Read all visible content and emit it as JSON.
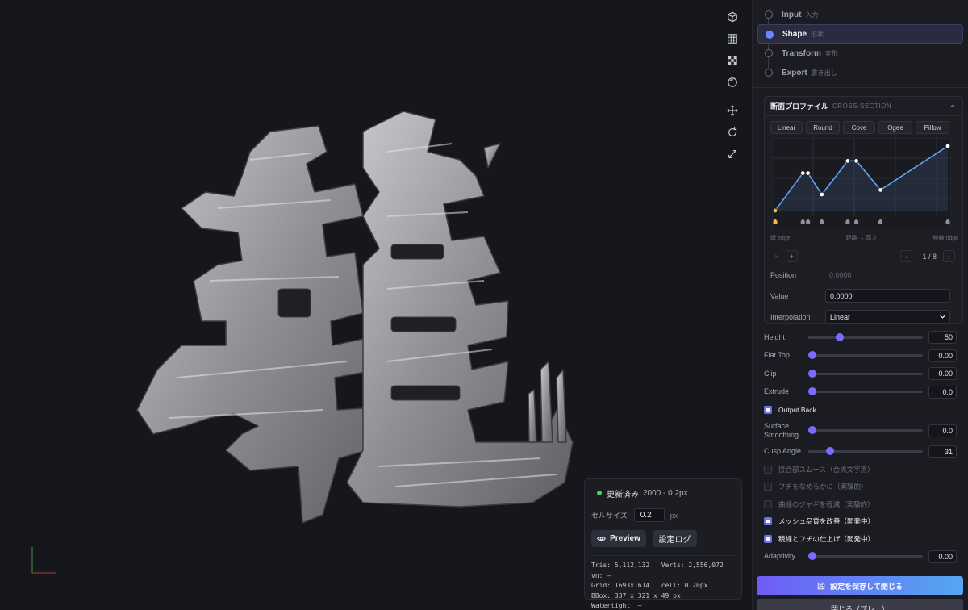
{
  "viewport": {
    "toolbar": [
      "cube-icon",
      "grid-icon",
      "checker-icon",
      "sphere-icon",
      "move-icon",
      "rotate-icon",
      "expand-icon"
    ]
  },
  "stats": {
    "status": "更新済み",
    "status_detail": "2000 - 0.2px",
    "cell_label": "セルサイズ",
    "cell_value": "0.2",
    "cell_unit": "px",
    "preview_label": "Preview",
    "log_label": "設定ログ",
    "lines": [
      "Tris: 5,112,132   Verts: 2,556,072",
      "vn: –",
      "Grid: 1693x1614   cell: 0.20px",
      "BBox: 337 x 321 x 49 px",
      "Watertight: –"
    ]
  },
  "steps": [
    {
      "en": "Input",
      "jp": "入力",
      "active": false
    },
    {
      "en": "Shape",
      "jp": "形状",
      "active": true
    },
    {
      "en": "Transform",
      "jp": "変形",
      "active": false
    },
    {
      "en": "Export",
      "jp": "書き出し",
      "active": false
    }
  ],
  "cross_section": {
    "title": "断面プロファイル",
    "subtitle": "CROSS-SECTION",
    "presets": [
      "Linear",
      "Round",
      "Cove",
      "Ogee",
      "Pillow"
    ],
    "curve_points": [
      [
        0,
        0
      ],
      [
        0.16,
        0.58
      ],
      [
        0.19,
        0.58
      ],
      [
        0.27,
        0.25
      ],
      [
        0.42,
        0.77
      ],
      [
        0.47,
        0.77
      ],
      [
        0.61,
        0.32
      ],
      [
        1.0,
        1.0
      ]
    ],
    "label_left": "縁 edge",
    "label_mid": "距離 → 高さ",
    "label_right": "稜線 ridge",
    "remove": "×",
    "add": "+",
    "pager": "1 / 8",
    "prev": "‹",
    "next": "›",
    "position_label": "Position",
    "position_value": "0.0000",
    "value_label": "Value",
    "value_value": "0.0000",
    "interp_label": "Interpolation",
    "interp_value": "Linear"
  },
  "sliders": [
    {
      "label": "Height",
      "value": "50",
      "level": 0.26
    },
    {
      "label": "Flat Top",
      "value": "0.00",
      "level": 0.0
    },
    {
      "label": "Clip",
      "value": "0.00",
      "level": 0.0
    },
    {
      "label": "Extrude",
      "value": "0.0",
      "level": 0.0
    }
  ],
  "output_back": {
    "label": "Output Back",
    "checked": true
  },
  "sliders2": [
    {
      "label": "Surface\nSmoothing",
      "value": "0.0",
      "level": 0.0
    },
    {
      "label": "Cusp Angle",
      "value": "31",
      "level": 0.17
    }
  ],
  "options": [
    {
      "label": "接合部スムース（合流文字用）",
      "checked": false
    },
    {
      "label": "フチをなめらかに（実験的）",
      "checked": false
    },
    {
      "label": "曲線のジャギを軽減（実験的）",
      "checked": false
    },
    {
      "label": "メッシュ品質を改善（開発中）",
      "checked": true
    },
    {
      "label": "稜線とフチの仕上げ（開発中）",
      "checked": true
    }
  ],
  "adaptivity": {
    "label": "Adaptivity",
    "value": "0.00",
    "level": 0.0
  },
  "save_label": "設定を保存して閉じる",
  "close_label": "閉じる（プレ…）",
  "colors": {
    "accent": "#6e86ff",
    "status_ok": "#49d16a",
    "curve": "#63a8ff",
    "save_start": "#6f5cf5",
    "save_end": "#54a7f2"
  }
}
